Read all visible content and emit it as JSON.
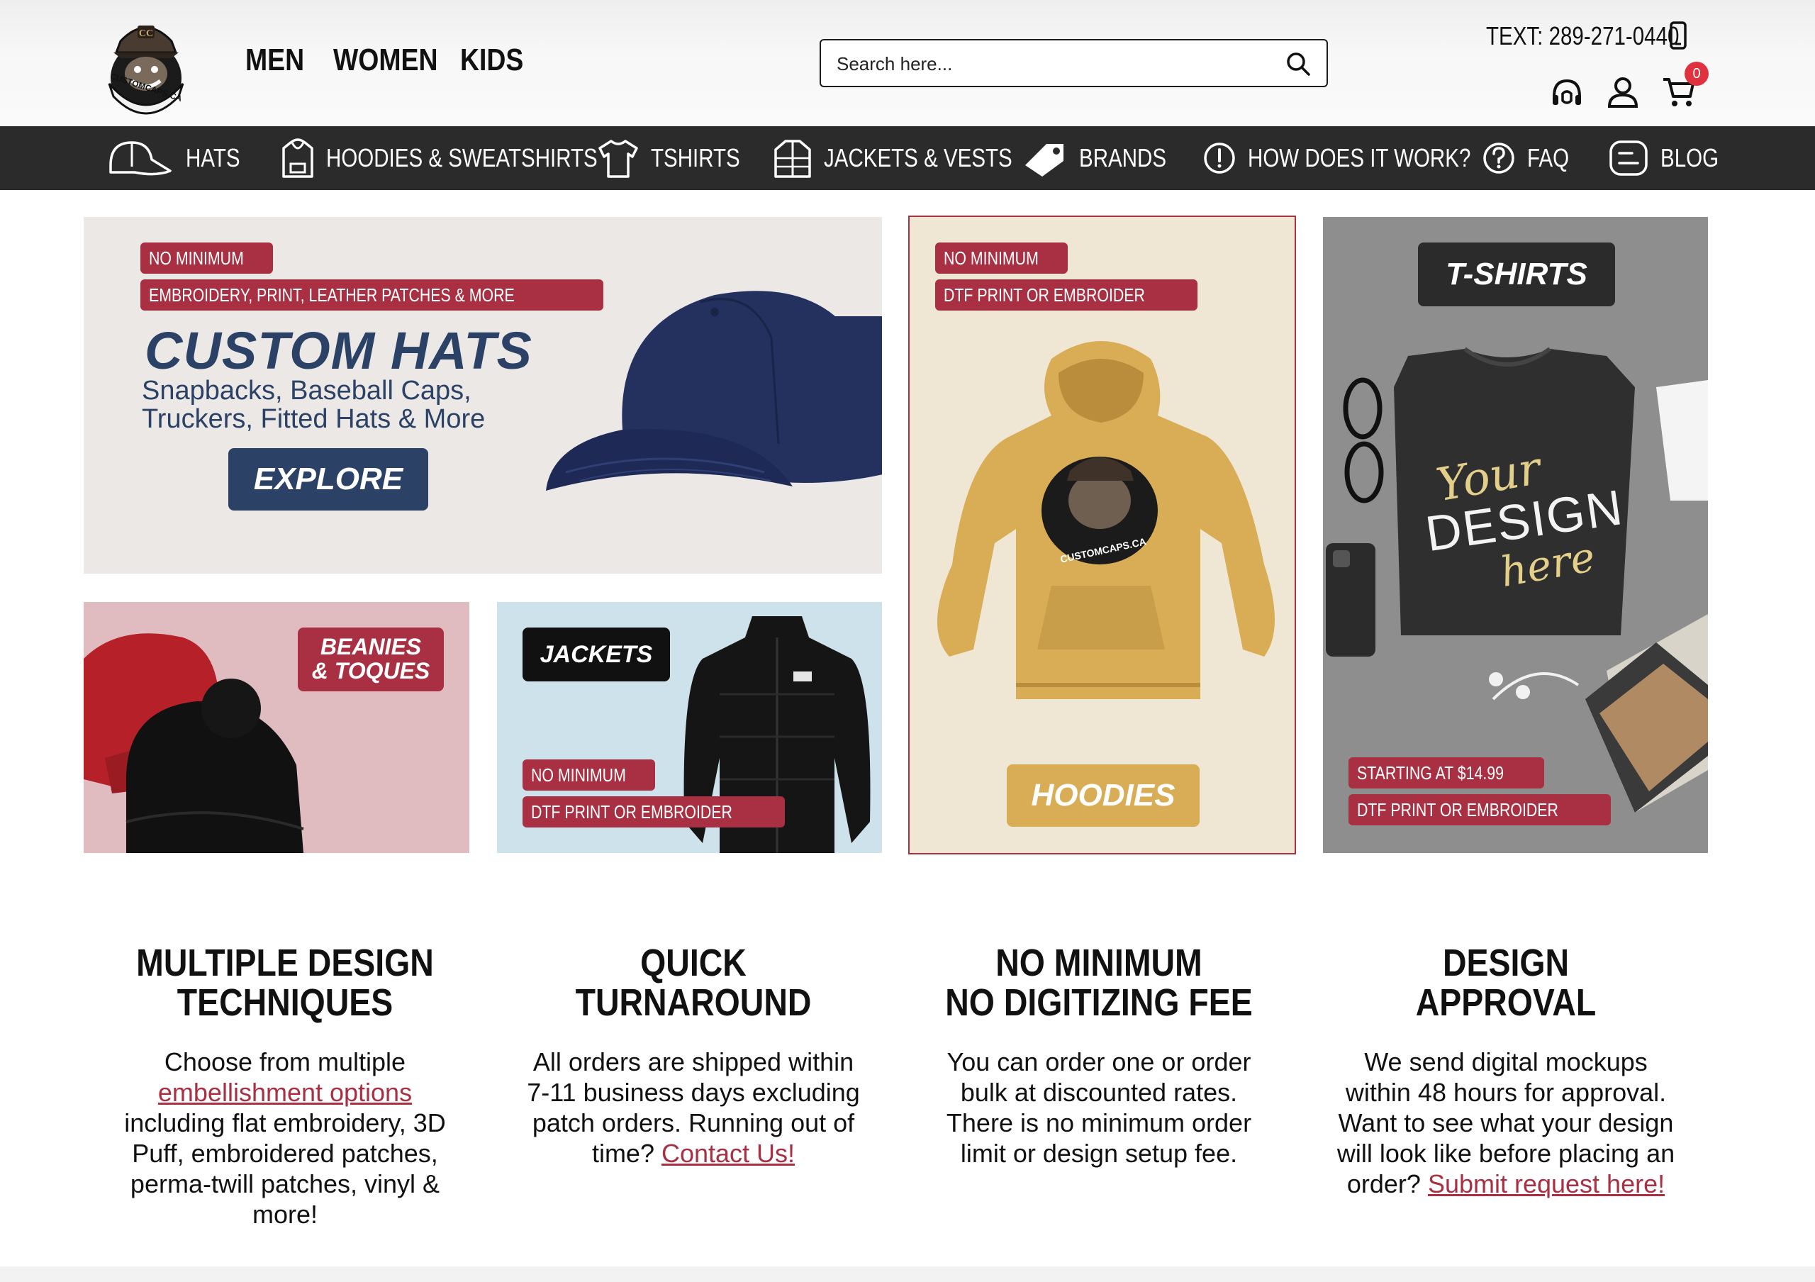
{
  "header": {
    "logo_text": "CUSTOMCAPS.CA",
    "nav": [
      "MEN",
      "WOMEN",
      "KIDS"
    ],
    "search_placeholder": "Search here...",
    "phone": "TEXT: 289-271-0440",
    "cart_count": "0",
    "icons": [
      "phone-icon",
      "support-icon",
      "account-icon",
      "cart-icon",
      "search-icon"
    ]
  },
  "categories": [
    {
      "label": "HATS",
      "icon": "hat-icon"
    },
    {
      "label": "HOODIES & SWEATSHIRTS",
      "icon": "hoodie-icon"
    },
    {
      "label": "TSHIRTS",
      "icon": "tshirt-icon"
    },
    {
      "label": "JACKETS & VESTS",
      "icon": "jacket-icon"
    },
    {
      "label": "BRANDS",
      "icon": "tag-icon"
    },
    {
      "label": "HOW DOES IT WORK?",
      "icon": "info-icon"
    },
    {
      "label": "FAQ",
      "icon": "question-icon"
    },
    {
      "label": "BLOG",
      "icon": "blog-icon"
    }
  ],
  "tiles": {
    "hats": {
      "tags": [
        "NO MINIMUM",
        "EMBROIDERY, PRINT, LEATHER PATCHES & MORE"
      ],
      "title": "CUSTOM HATS",
      "subtitle_1": "Snapbacks, Baseball Caps,",
      "subtitle_2": "Truckers, Fitted Hats & More",
      "cta": "EXPLORE"
    },
    "hoodies": {
      "tags": [
        "NO MINIMUM",
        "DTF PRINT OR EMBROIDER"
      ],
      "title": "HOODIES",
      "print_text": "CUSTOMCAPS.CA"
    },
    "tshirts": {
      "title": "T-SHIRTS",
      "design_1": "Your",
      "design_2": "DESIGN",
      "design_3": "here",
      "tags": [
        "STARTING AT $14.99",
        "DTF PRINT OR EMBROIDER"
      ]
    },
    "beanies": {
      "title_1": "BEANIES",
      "title_2": "& TOQUES"
    },
    "jackets": {
      "title": "JACKETS",
      "tags": [
        "NO MINIMUM",
        "DTF PRINT OR EMBROIDER"
      ]
    }
  },
  "features": [
    {
      "heading_1": "MULTIPLE DESIGN",
      "heading_2": "TECHNIQUES",
      "line_1": "Choose from multiple",
      "link": "embellishment options",
      "line_2": "including flat embroidery, 3D",
      "line_3": "Puff, embroidered patches,",
      "line_4": "perma-twill patches, vinyl &",
      "line_5": "more!"
    },
    {
      "heading_1": "QUICK",
      "heading_2": "TURNAROUND",
      "line_1": "All orders are shipped within",
      "line_2": "7-11 business days excluding",
      "line_3": "patch orders. Running out of",
      "line_4": "time?",
      "link": "Contact Us!"
    },
    {
      "heading_1": "NO MINIMUM",
      "heading_2": "NO DIGITIZING FEE",
      "line_1": "You can order one or order",
      "line_2": "bulk at discounted rates.",
      "line_3": "There is no minimum order",
      "line_4": "limit or design setup fee."
    },
    {
      "heading_1": "DESIGN",
      "heading_2": "APPROVAL",
      "line_1": "We send digital mockups",
      "line_2": "within 48 hours for approval.",
      "line_3": "Want to see what your design",
      "line_4": "will look like before placing an",
      "line_5": "order?",
      "link": "Submit request here!"
    }
  ],
  "colors": {
    "accent": "#a83042",
    "navbar": "#2b2b2b",
    "hat_title": "#2b4266",
    "hoodie_gold": "#d9ad55"
  }
}
